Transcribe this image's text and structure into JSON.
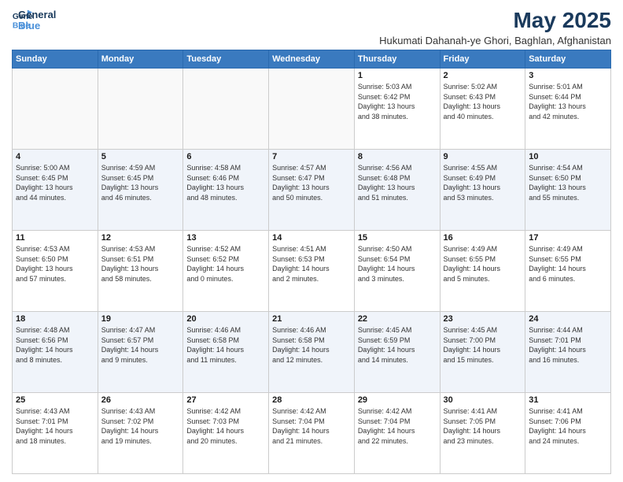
{
  "header": {
    "logo_line1": "General",
    "logo_line2": "Blue",
    "month_year": "May 2025",
    "location": "Hukumati Dahanah-ye Ghori, Baghlan, Afghanistan"
  },
  "days_of_week": [
    "Sunday",
    "Monday",
    "Tuesday",
    "Wednesday",
    "Thursday",
    "Friday",
    "Saturday"
  ],
  "weeks": [
    [
      {
        "num": "",
        "detail": ""
      },
      {
        "num": "",
        "detail": ""
      },
      {
        "num": "",
        "detail": ""
      },
      {
        "num": "",
        "detail": ""
      },
      {
        "num": "1",
        "detail": "Sunrise: 5:03 AM\nSunset: 6:42 PM\nDaylight: 13 hours\nand 38 minutes."
      },
      {
        "num": "2",
        "detail": "Sunrise: 5:02 AM\nSunset: 6:43 PM\nDaylight: 13 hours\nand 40 minutes."
      },
      {
        "num": "3",
        "detail": "Sunrise: 5:01 AM\nSunset: 6:44 PM\nDaylight: 13 hours\nand 42 minutes."
      }
    ],
    [
      {
        "num": "4",
        "detail": "Sunrise: 5:00 AM\nSunset: 6:45 PM\nDaylight: 13 hours\nand 44 minutes."
      },
      {
        "num": "5",
        "detail": "Sunrise: 4:59 AM\nSunset: 6:45 PM\nDaylight: 13 hours\nand 46 minutes."
      },
      {
        "num": "6",
        "detail": "Sunrise: 4:58 AM\nSunset: 6:46 PM\nDaylight: 13 hours\nand 48 minutes."
      },
      {
        "num": "7",
        "detail": "Sunrise: 4:57 AM\nSunset: 6:47 PM\nDaylight: 13 hours\nand 50 minutes."
      },
      {
        "num": "8",
        "detail": "Sunrise: 4:56 AM\nSunset: 6:48 PM\nDaylight: 13 hours\nand 51 minutes."
      },
      {
        "num": "9",
        "detail": "Sunrise: 4:55 AM\nSunset: 6:49 PM\nDaylight: 13 hours\nand 53 minutes."
      },
      {
        "num": "10",
        "detail": "Sunrise: 4:54 AM\nSunset: 6:50 PM\nDaylight: 13 hours\nand 55 minutes."
      }
    ],
    [
      {
        "num": "11",
        "detail": "Sunrise: 4:53 AM\nSunset: 6:50 PM\nDaylight: 13 hours\nand 57 minutes."
      },
      {
        "num": "12",
        "detail": "Sunrise: 4:53 AM\nSunset: 6:51 PM\nDaylight: 13 hours\nand 58 minutes."
      },
      {
        "num": "13",
        "detail": "Sunrise: 4:52 AM\nSunset: 6:52 PM\nDaylight: 14 hours\nand 0 minutes."
      },
      {
        "num": "14",
        "detail": "Sunrise: 4:51 AM\nSunset: 6:53 PM\nDaylight: 14 hours\nand 2 minutes."
      },
      {
        "num": "15",
        "detail": "Sunrise: 4:50 AM\nSunset: 6:54 PM\nDaylight: 14 hours\nand 3 minutes."
      },
      {
        "num": "16",
        "detail": "Sunrise: 4:49 AM\nSunset: 6:55 PM\nDaylight: 14 hours\nand 5 minutes."
      },
      {
        "num": "17",
        "detail": "Sunrise: 4:49 AM\nSunset: 6:55 PM\nDaylight: 14 hours\nand 6 minutes."
      }
    ],
    [
      {
        "num": "18",
        "detail": "Sunrise: 4:48 AM\nSunset: 6:56 PM\nDaylight: 14 hours\nand 8 minutes."
      },
      {
        "num": "19",
        "detail": "Sunrise: 4:47 AM\nSunset: 6:57 PM\nDaylight: 14 hours\nand 9 minutes."
      },
      {
        "num": "20",
        "detail": "Sunrise: 4:46 AM\nSunset: 6:58 PM\nDaylight: 14 hours\nand 11 minutes."
      },
      {
        "num": "21",
        "detail": "Sunrise: 4:46 AM\nSunset: 6:58 PM\nDaylight: 14 hours\nand 12 minutes."
      },
      {
        "num": "22",
        "detail": "Sunrise: 4:45 AM\nSunset: 6:59 PM\nDaylight: 14 hours\nand 14 minutes."
      },
      {
        "num": "23",
        "detail": "Sunrise: 4:45 AM\nSunset: 7:00 PM\nDaylight: 14 hours\nand 15 minutes."
      },
      {
        "num": "24",
        "detail": "Sunrise: 4:44 AM\nSunset: 7:01 PM\nDaylight: 14 hours\nand 16 minutes."
      }
    ],
    [
      {
        "num": "25",
        "detail": "Sunrise: 4:43 AM\nSunset: 7:01 PM\nDaylight: 14 hours\nand 18 minutes."
      },
      {
        "num": "26",
        "detail": "Sunrise: 4:43 AM\nSunset: 7:02 PM\nDaylight: 14 hours\nand 19 minutes."
      },
      {
        "num": "27",
        "detail": "Sunrise: 4:42 AM\nSunset: 7:03 PM\nDaylight: 14 hours\nand 20 minutes."
      },
      {
        "num": "28",
        "detail": "Sunrise: 4:42 AM\nSunset: 7:04 PM\nDaylight: 14 hours\nand 21 minutes."
      },
      {
        "num": "29",
        "detail": "Sunrise: 4:42 AM\nSunset: 7:04 PM\nDaylight: 14 hours\nand 22 minutes."
      },
      {
        "num": "30",
        "detail": "Sunrise: 4:41 AM\nSunset: 7:05 PM\nDaylight: 14 hours\nand 23 minutes."
      },
      {
        "num": "31",
        "detail": "Sunrise: 4:41 AM\nSunset: 7:06 PM\nDaylight: 14 hours\nand 24 minutes."
      }
    ]
  ]
}
